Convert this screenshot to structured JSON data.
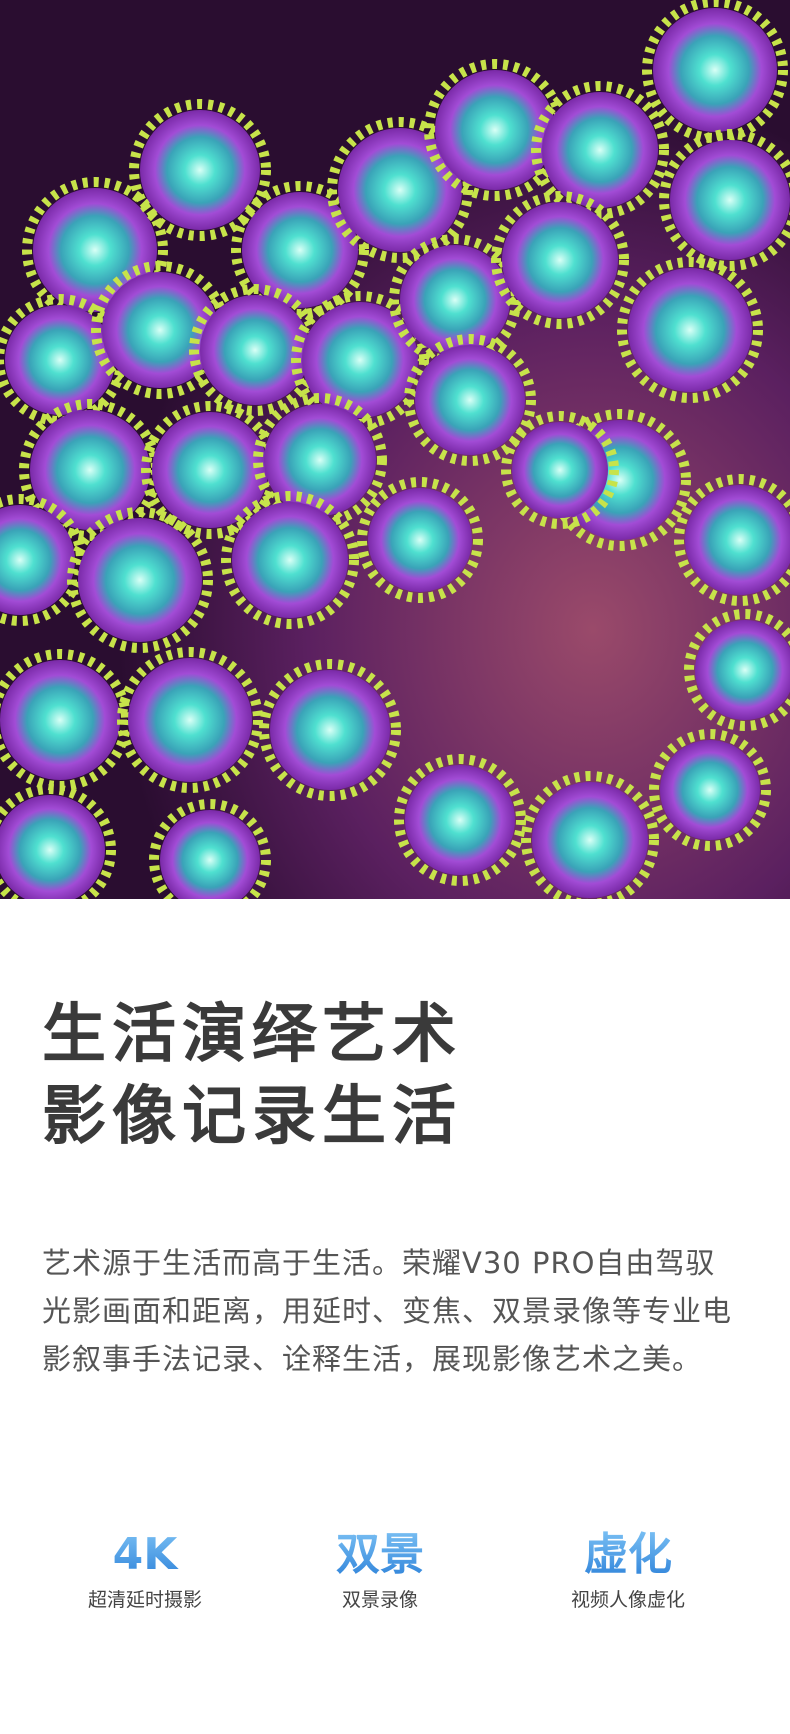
{
  "hero": {
    "image": "zoanthid-coral-photo",
    "colors": {
      "coral_center": "#4fe0d0",
      "coral_petals": "#a24cd6",
      "coral_tips": "#c7e34a",
      "rock": "#6a2c6e"
    }
  },
  "headline": {
    "line1": "生活演绎艺术",
    "line2": "影像记录生活"
  },
  "body": {
    "paragraph": "艺术源于生活而高于生活。荣耀V30 PRO自由驾驭光影画面和距离，用延时、变焦、双景录像等专业电影叙事手法记录、诠释生活，展现影像艺术之美。"
  },
  "features": [
    {
      "title": "4K",
      "caption": "超清延时摄影"
    },
    {
      "title": "双景",
      "caption": "双景录像"
    },
    {
      "title": "虚化",
      "caption": "视频人像虚化"
    }
  ],
  "accent": {
    "gradient_top": "#7ec3f5",
    "gradient_bottom": "#2a7fd8"
  }
}
